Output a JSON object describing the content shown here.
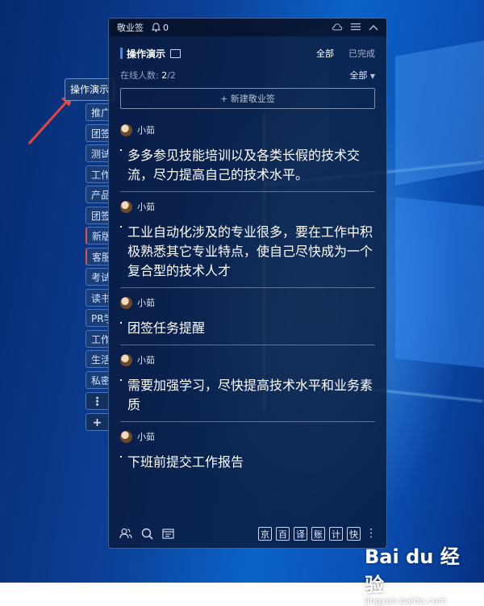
{
  "app": {
    "title": "敬业签",
    "notification_count": "0"
  },
  "group": {
    "name": "操作演示",
    "filter_all": "全部",
    "filter_done": "已完成"
  },
  "online": {
    "label": "在线人数:",
    "count": "2",
    "total": "/2",
    "scope": "全部"
  },
  "new_note_label": "+ 新建敬业签",
  "notes": [
    {
      "author": "小茹",
      "text": "多多参见技能培训以及各类长假的技术交流，尽力提高自己的技术水平。"
    },
    {
      "author": "小茹",
      "text": "工业自动化涉及的专业很多，要在工作中积极熟悉其它专业特点，使自己尽快成为一个复合型的技术人才"
    },
    {
      "author": "小茹",
      "text": "团签任务提醒"
    },
    {
      "author": "小茹",
      "text": "需要加强学习，尽快提高技术水平和业务素质"
    },
    {
      "author": "小茹",
      "text": "下班前提交工作报告"
    }
  ],
  "side_tabs": {
    "active": "操作演示",
    "items": [
      "推广",
      "团签",
      "测试",
      "工作",
      "产品",
      "团签",
      "新版",
      "客服",
      "考试",
      "读书",
      "PR学",
      "工作",
      "生活",
      "私密"
    ],
    "more": "⋮",
    "add": "+"
  },
  "footer_tools": [
    "京",
    "百",
    "译",
    "账",
    "计",
    "快"
  ],
  "icons": {
    "bell": "bell-icon",
    "cloud": "cloud-icon",
    "menu": "menu-icon",
    "collapse": "chevron-up-icon",
    "members": "members-icon",
    "search": "search-icon",
    "calendar": "calendar-icon"
  },
  "watermark": {
    "logo": "Bai du 经验",
    "url": "jingyan.baidu.com"
  },
  "colors": {
    "accent": "#3d8bff",
    "window_bg": "#0a1a3a",
    "desktop": "#0a63c9"
  }
}
